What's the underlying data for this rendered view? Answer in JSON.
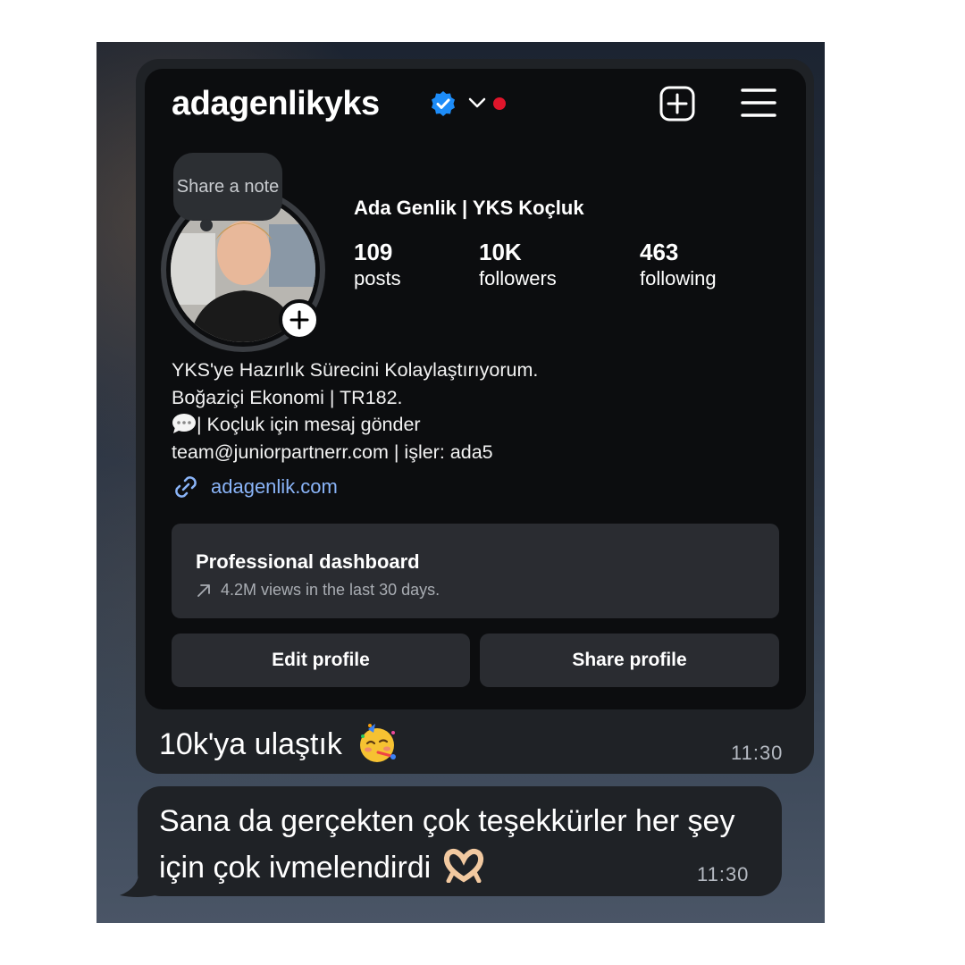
{
  "profile": {
    "username": "adagenlikyks",
    "display_name": "Ada Genlik | YKS Koçluk",
    "note_label": "Share a note",
    "stats": [
      {
        "value": "109",
        "label": "posts"
      },
      {
        "value": "10K",
        "label": "followers"
      },
      {
        "value": "463",
        "label": "following"
      }
    ],
    "bio": {
      "line1": "YKS'ye Hazırlık Sürecini Kolaylaştırıyorum.",
      "line2": "Boğaziçi Ekonomi | TR182.",
      "line3": "| Koçluk için mesaj gönder",
      "line4": "team@juniorpartnerr.com | işler: ada5"
    },
    "link": "adagenlik.com",
    "dashboard": {
      "title": "Professional dashboard",
      "subtitle": "4.2M views in the last 30 days."
    },
    "buttons": {
      "edit": "Edit profile",
      "share": "Share profile"
    }
  },
  "messages": [
    {
      "text": "10k'ya ulaştık",
      "emoji": "party-face",
      "time": "11:30"
    },
    {
      "text": "Sana da gerçekten çok teşekkürler her şey için çok ivmelendirdi",
      "emoji": "heart-hands",
      "time": "11:30"
    }
  ],
  "colors": {
    "link": "#8ab4f8",
    "verified": "#1d8cf8",
    "notification_dot": "#e0152b",
    "bubble": "#1f2226"
  },
  "icons": [
    "verified-badge-icon",
    "chevron-down-icon",
    "add-post-icon",
    "menu-icon",
    "plus-icon",
    "link-icon",
    "trend-arrow-icon",
    "chat-bubble-icon"
  ]
}
